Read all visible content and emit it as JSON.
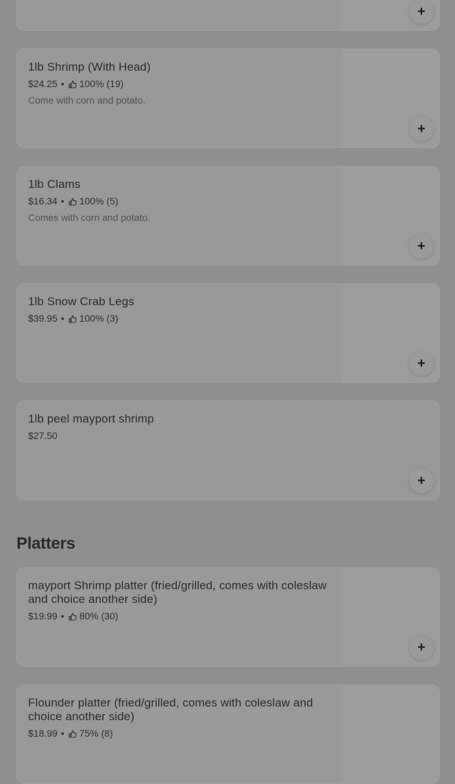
{
  "items": [
    {
      "name": "",
      "price": "",
      "rating": "",
      "description": "",
      "add_label": "+"
    },
    {
      "name": "1lb Shrimp (With Head)",
      "price": "$24.25",
      "rating": "100% (19)",
      "description": "Come with corn and potato.",
      "add_label": "+"
    },
    {
      "name": "1lb Clams",
      "price": "$16.34",
      "rating": "100% (5)",
      "description": "Comes with corn and potato.",
      "add_label": "+"
    },
    {
      "name": "1lb Snow Crab Legs",
      "price": "$39.95",
      "rating": "100% (3)",
      "description": "",
      "add_label": "+"
    },
    {
      "name": "1lb peel mayport shrimp",
      "price": "$27.50",
      "rating": "",
      "description": "",
      "add_label": "+"
    }
  ],
  "platters": {
    "title": "Platters",
    "items": [
      {
        "name": "mayport Shrimp platter (fried/grilled, comes with coleslaw and choice another side)",
        "price": "$19.99",
        "rating": "80% (30)",
        "add_label": "+"
      },
      {
        "name": "Flounder platter (fried/grilled, comes with coleslaw and choice another side)",
        "price": "$18.99",
        "rating": "75% (8)",
        "add_label": "+"
      }
    ]
  },
  "separator": "•",
  "icons": {
    "rating": "thumbs-up-icon",
    "add": "plus-icon"
  }
}
